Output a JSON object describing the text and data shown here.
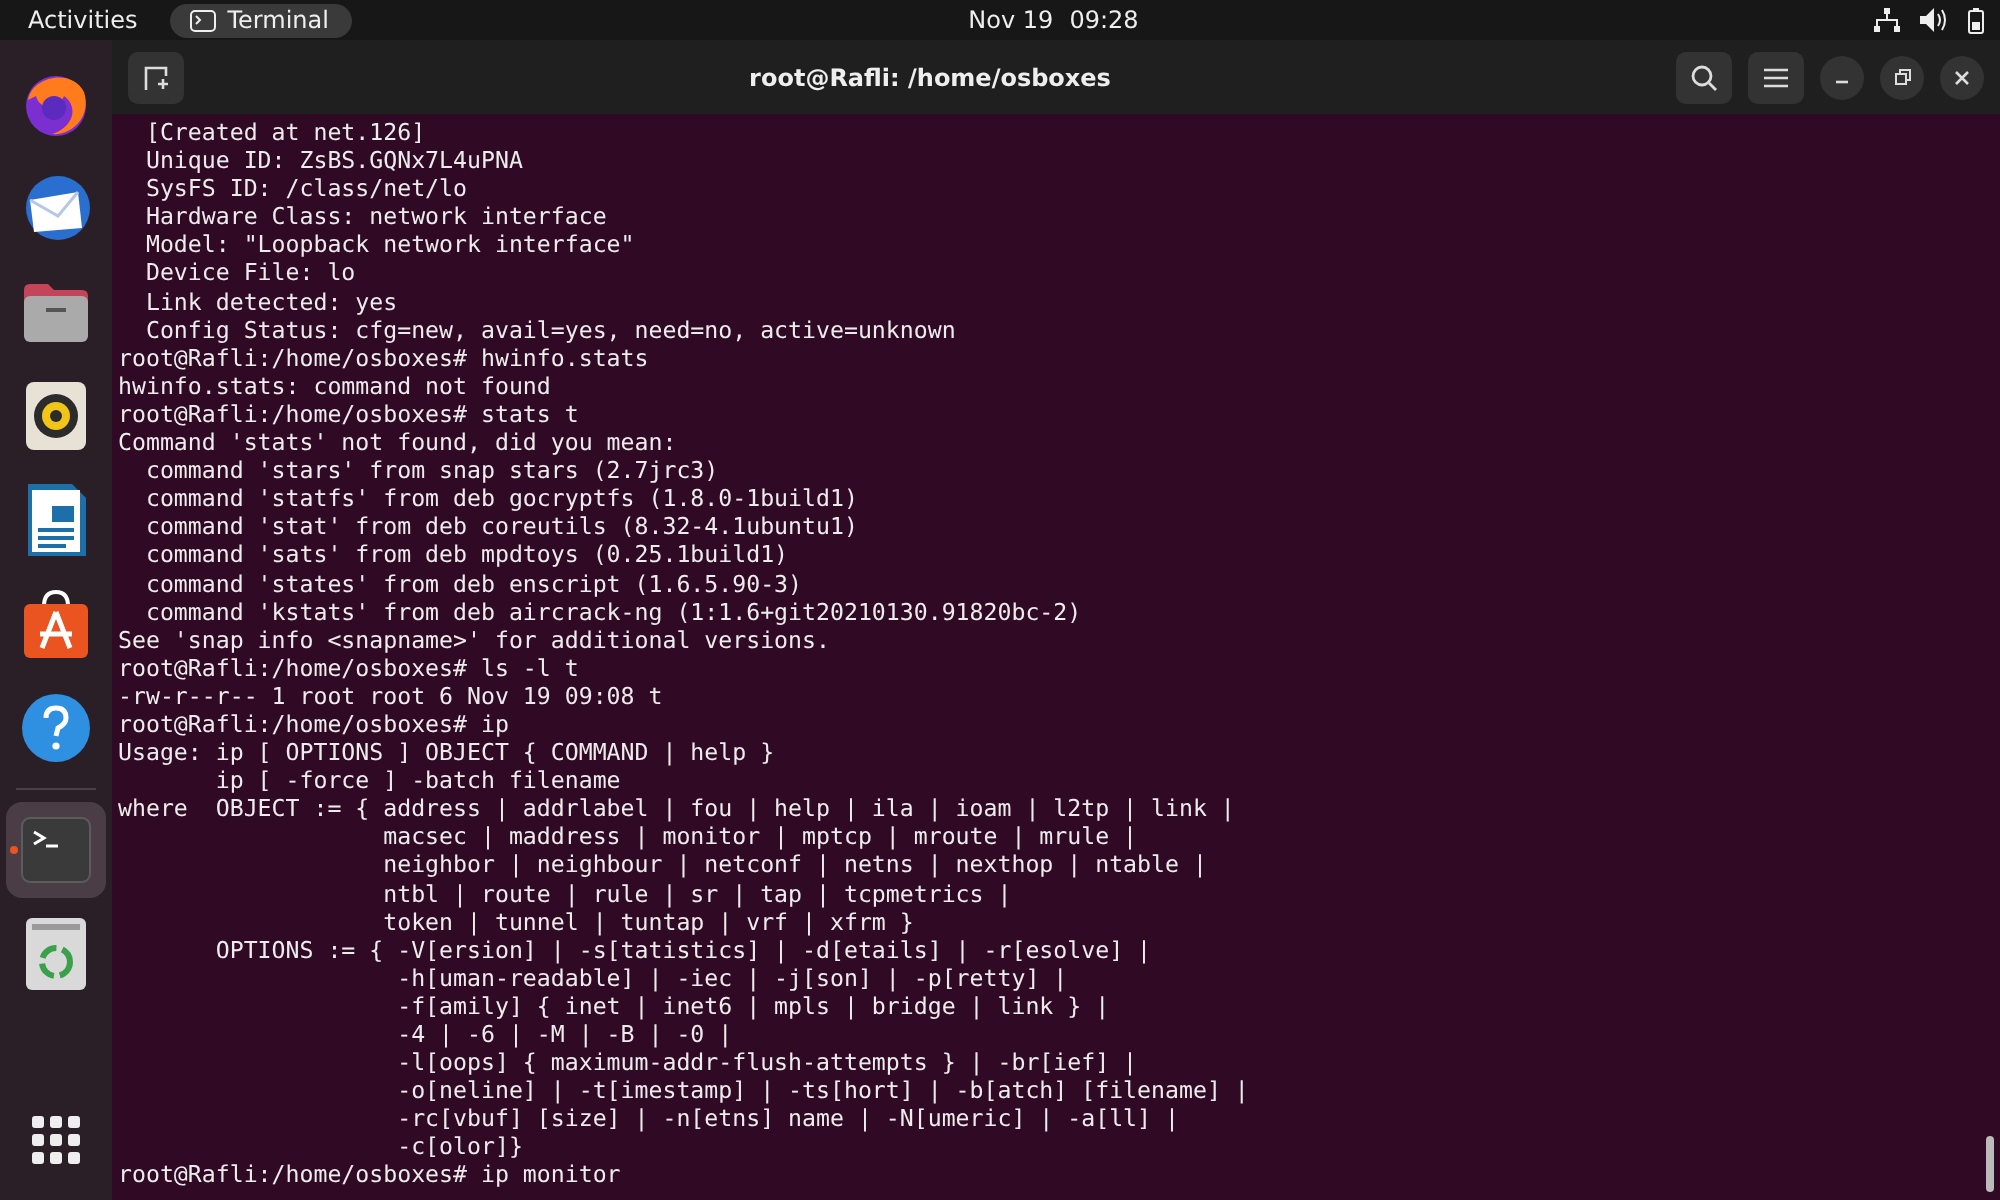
{
  "top_bar": {
    "activities": "Activities",
    "app": "Terminal",
    "date": "Nov 19",
    "time": "09:28"
  },
  "dock": {
    "items": [
      {
        "kind": "browser",
        "selected": false
      },
      {
        "kind": "mail",
        "selected": false
      },
      {
        "kind": "folder",
        "selected": false
      },
      {
        "kind": "speaker",
        "selected": false
      },
      {
        "kind": "document",
        "selected": false
      },
      {
        "kind": "store",
        "selected": false
      },
      {
        "kind": "help",
        "selected": false
      },
      {
        "kind": "terminal",
        "selected": true
      },
      {
        "kind": "trash",
        "selected": false
      }
    ]
  },
  "window": {
    "title": "root@Rafli: /home/osboxes",
    "lines": [
      "  [Created at net.126]",
      "  Unique ID: ZsBS.GQNx7L4uPNA",
      "  SysFS ID: /class/net/lo",
      "  Hardware Class: network interface",
      "  Model: \"Loopback network interface\"",
      "  Device File: lo",
      "  Link detected: yes",
      "  Config Status: cfg=new, avail=yes, need=no, active=unknown",
      "root@Rafli:/home/osboxes# hwinfo.stats",
      "hwinfo.stats: command not found",
      "root@Rafli:/home/osboxes# stats t",
      "Command 'stats' not found, did you mean:",
      "  command 'stars' from snap stars (2.7jrc3)",
      "  command 'statfs' from deb gocryptfs (1.8.0-1build1)",
      "  command 'stat' from deb coreutils (8.32-4.1ubuntu1)",
      "  command 'sats' from deb mpdtoys (0.25.1build1)",
      "  command 'states' from deb enscript (1.6.5.90-3)",
      "  command 'kstats' from deb aircrack-ng (1:1.6+git20210130.91820bc-2)",
      "See 'snap info <snapname>' for additional versions.",
      "root@Rafli:/home/osboxes# ls -l t",
      "-rw-r--r-- 1 root root 6 Nov 19 09:08 t",
      "root@Rafli:/home/osboxes# ip",
      "Usage: ip [ OPTIONS ] OBJECT { COMMAND | help }",
      "       ip [ -force ] -batch filename",
      "where  OBJECT := { address | addrlabel | fou | help | ila | ioam | l2tp | link |",
      "                   macsec | maddress | monitor | mptcp | mroute | mrule |",
      "                   neighbor | neighbour | netconf | netns | nexthop | ntable |",
      "                   ntbl | route | rule | sr | tap | tcpmetrics |",
      "                   token | tunnel | tuntap | vrf | xfrm }",
      "       OPTIONS := { -V[ersion] | -s[tatistics] | -d[etails] | -r[esolve] |",
      "                    -h[uman-readable] | -iec | -j[son] | -p[retty] |",
      "                    -f[amily] { inet | inet6 | mpls | bridge | link } |",
      "                    -4 | -6 | -M | -B | -0 |",
      "                    -l[oops] { maximum-addr-flush-attempts } | -br[ief] |",
      "                    -o[neline] | -t[imestamp] | -ts[hort] | -b[atch] [filename] |",
      "                    -rc[vbuf] [size] | -n[etns] name | -N[umeric] | -a[ll] |",
      "                    -c[olor]}",
      "root@Rafli:/home/osboxes# ip monitor"
    ]
  }
}
